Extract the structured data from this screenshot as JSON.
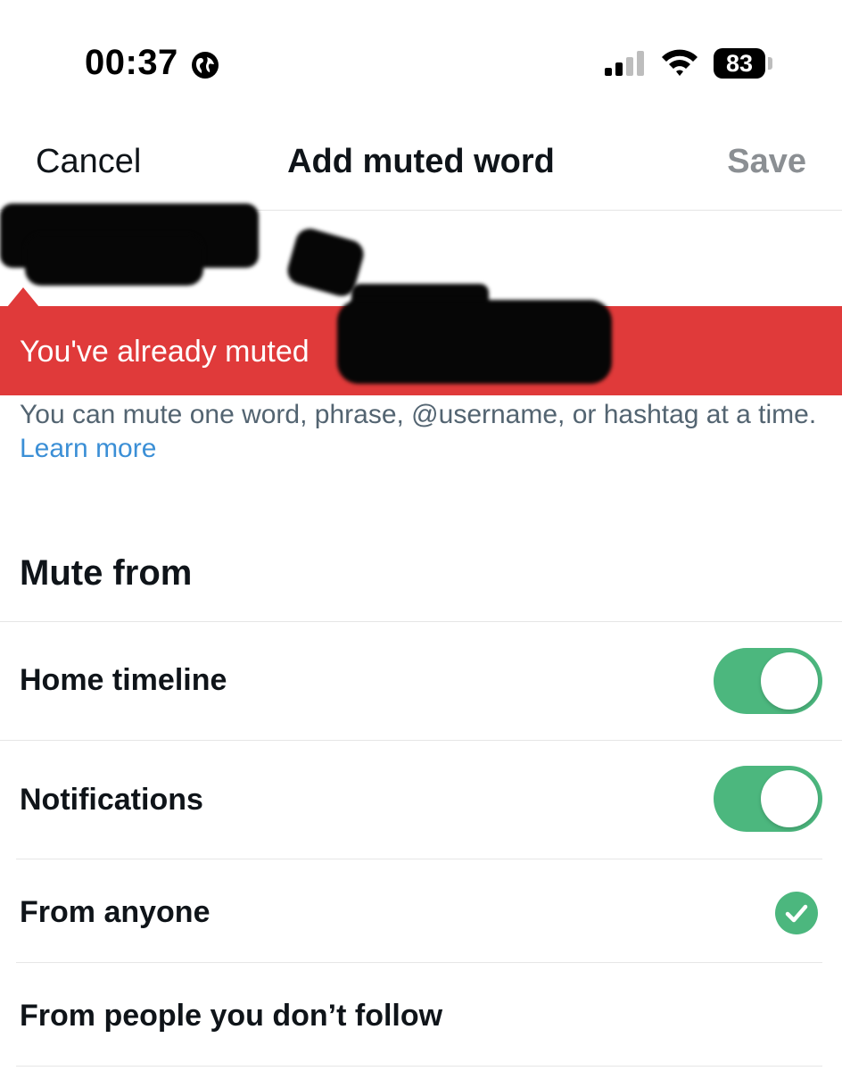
{
  "status_bar": {
    "time": "00:37",
    "battery": "83"
  },
  "nav": {
    "cancel_label": "Cancel",
    "title": "Add muted word",
    "save_label": "Save"
  },
  "error_banner": {
    "message": "You've already muted "
  },
  "helper": {
    "text": "You can mute one word, phrase, @username, or hashtag at a time. ",
    "link": "Learn more"
  },
  "mute_from": {
    "title": "Mute from",
    "options": [
      {
        "label": "Home timeline",
        "enabled": true
      },
      {
        "label": "Notifications",
        "enabled": true
      }
    ]
  },
  "audience": {
    "options": [
      {
        "label": "From anyone",
        "selected": true
      },
      {
        "label": "From people you don’t follow",
        "selected": false
      }
    ]
  },
  "colors": {
    "error_red": "#e03a3a",
    "toggle_green": "#4cb77e",
    "link_blue": "#3b8fd6",
    "muted_gray": "#8b8f93"
  }
}
